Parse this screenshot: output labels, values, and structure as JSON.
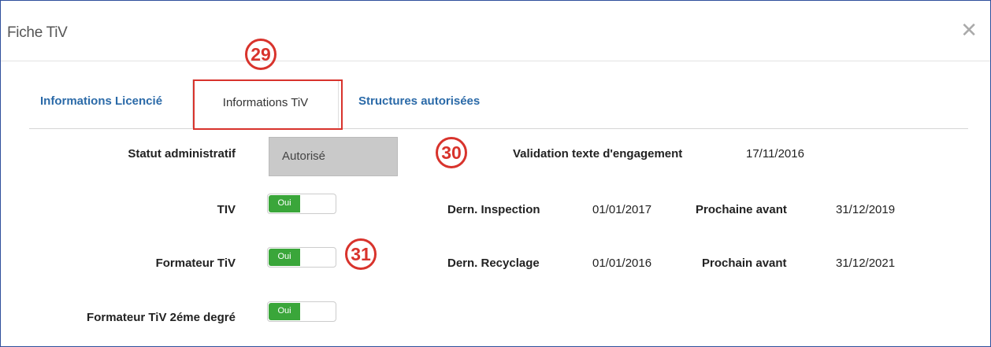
{
  "modal": {
    "title": "Fiche TiV",
    "close_icon": "close-icon"
  },
  "tabs": [
    {
      "label": "Informations Licencié"
    },
    {
      "label": "Informations TiV"
    },
    {
      "label": "Structures autorisées"
    }
  ],
  "annotations": {
    "a29": "29",
    "a30": "30",
    "a31": "31"
  },
  "fields": {
    "statut_label": "Statut administratif",
    "statut_value": "Autorisé",
    "validation_label": "Validation texte d'engagement",
    "validation_value": "17/11/2016",
    "tiv_label": "TIV",
    "formateur_label": "Formateur TiV",
    "formateur2_label": "Formateur TiV 2éme degré",
    "toggle_label": "Oui",
    "dern_inspection_label": "Dern. Inspection",
    "dern_inspection_value": "01/01/2017",
    "prochaine_avant_label": "Prochaine avant",
    "prochaine_avant_value": "31/12/2019",
    "dern_recyclage_label": "Dern. Recyclage",
    "dern_recyclage_value": "01/01/2016",
    "prochain_avant_label": "Prochain avant",
    "prochain_avant_value": "31/12/2021"
  },
  "colors": {
    "accent": "#2b6aa8",
    "toggle_on": "#3aa63a",
    "annotation": "#d8332c"
  }
}
